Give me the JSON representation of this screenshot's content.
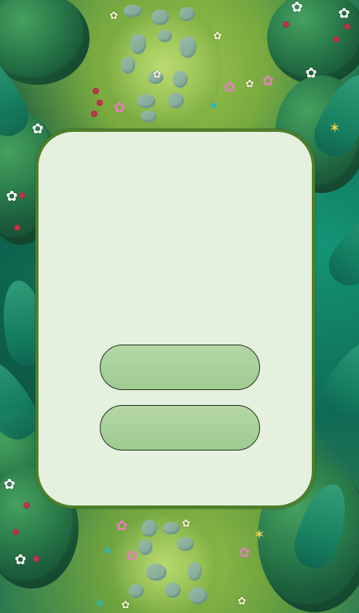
{
  "game": {
    "screen": "menu-dialog",
    "background": "forest-path",
    "dialog": {
      "buttons": [
        {
          "label": ""
        },
        {
          "label": ""
        }
      ]
    }
  },
  "colors": {
    "dialog_fill": "#e5f0de",
    "dialog_border": "#4d7f2c",
    "button_fill": "#a9d09a",
    "button_border": "#20371c",
    "forest_dark": "#0f5a43",
    "forest_light": "#8fbe4b"
  },
  "icons": {
    "decor": [
      "white-flower-icon",
      "pink-flower-icon",
      "yellow-butterfly-icon",
      "blue-butterfly-icon"
    ]
  }
}
